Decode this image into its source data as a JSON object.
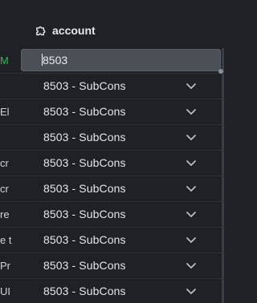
{
  "header": {
    "column_icon": "puzzle-piece-icon",
    "column_title": "account"
  },
  "editor": {
    "value": "8503"
  },
  "rows": [
    {
      "left_fragment": "M",
      "left_color": "#19c24a",
      "value": "",
      "editing": true
    },
    {
      "left_fragment": "",
      "value": "8503 - SubCons"
    },
    {
      "left_fragment": "El",
      "value": "8503 - SubCons"
    },
    {
      "left_fragment": "",
      "value": "8503 - SubCons"
    },
    {
      "left_fragment": "cr",
      "value": "8503 - SubCons"
    },
    {
      "left_fragment": "cr",
      "value": "8503 - SubCons"
    },
    {
      "left_fragment": "re",
      "value": "8503 - SubCons"
    },
    {
      "left_fragment": "e t",
      "value": "8503 - SubCons"
    },
    {
      "left_fragment": "Pr",
      "value": "8503 - SubCons"
    },
    {
      "left_fragment": "UI",
      "value": "8503 - SubCons"
    }
  ],
  "icons": {
    "dropdown": "chevron-down-icon"
  }
}
